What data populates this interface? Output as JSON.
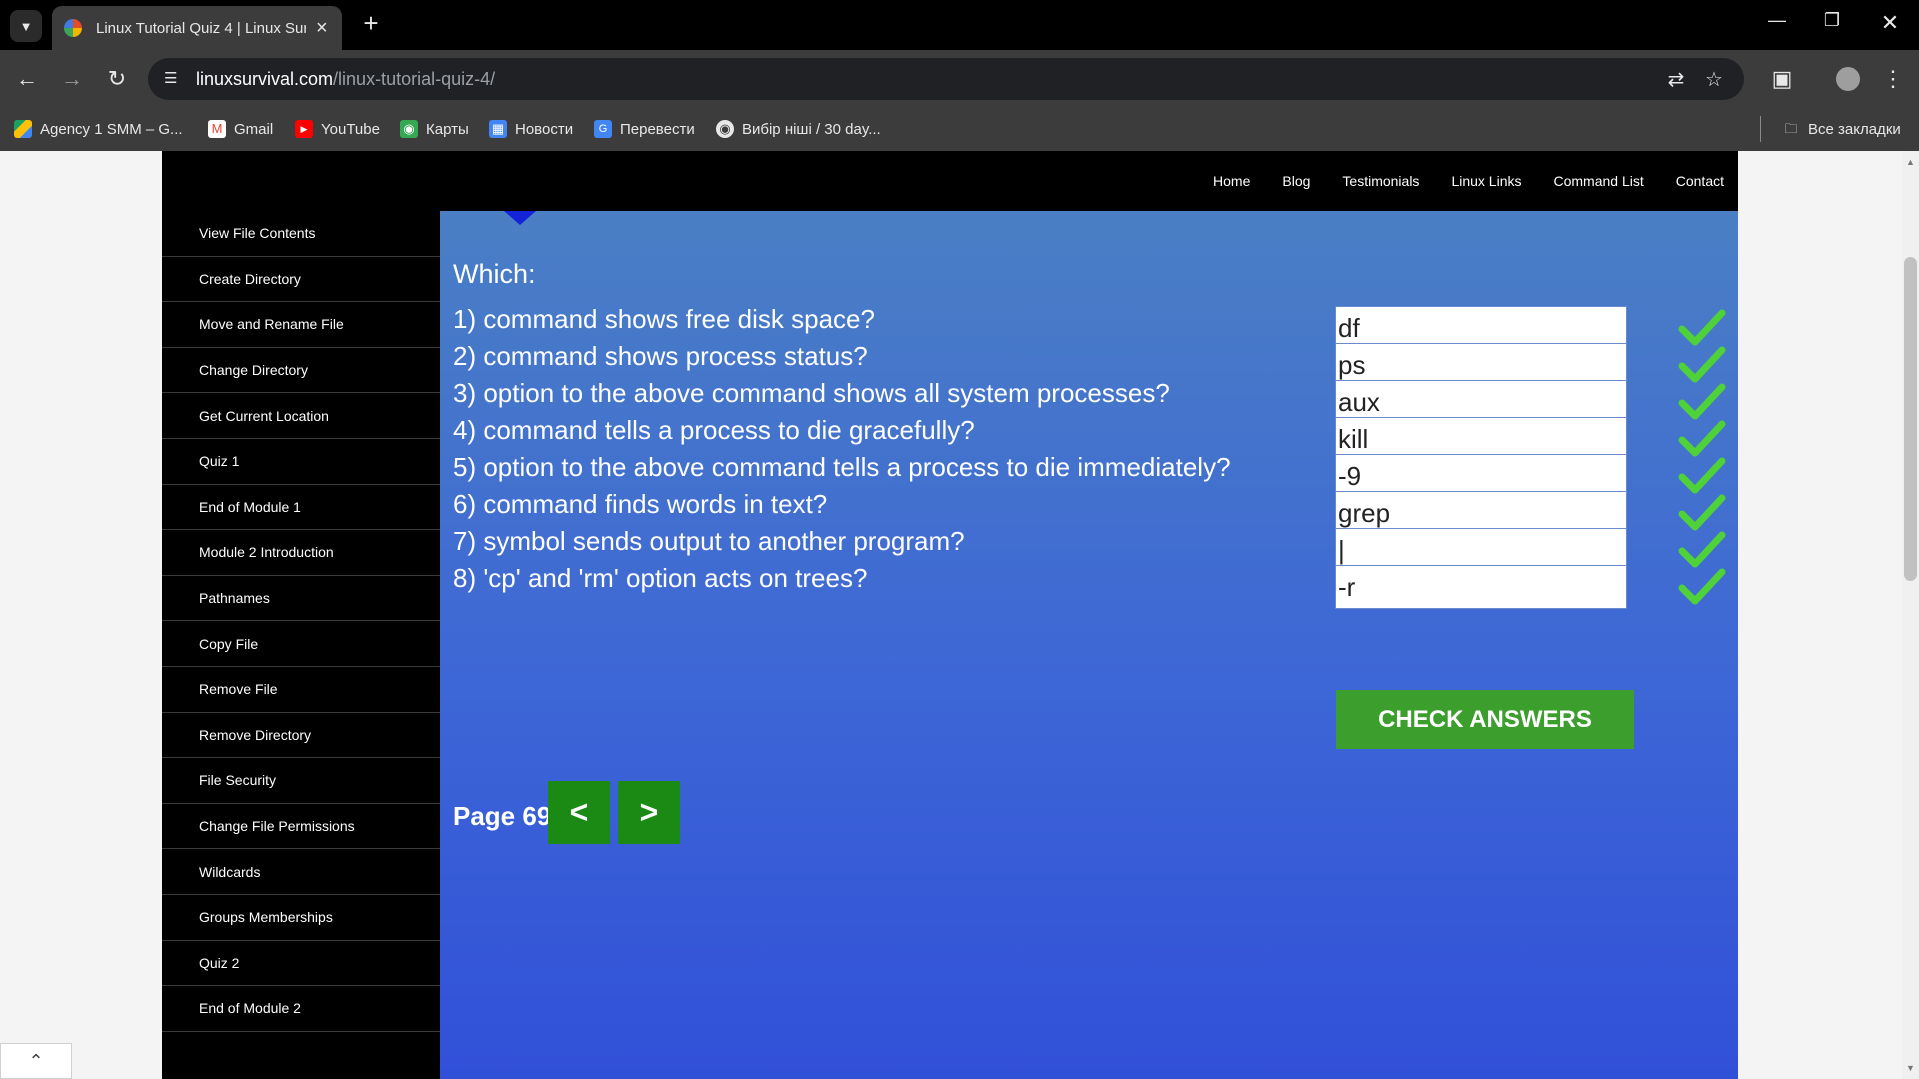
{
  "browser": {
    "tab_title": "Linux Tutorial Quiz 4 | Linux Survival",
    "url_host": "linuxsurvival.com",
    "url_path": "/linux-tutorial-quiz-4/",
    "bookmarks": [
      {
        "label": "Agency 1 SMM – G...",
        "icon": "google-drive-icon"
      },
      {
        "label": "Gmail",
        "icon": "gmail-icon"
      },
      {
        "label": "YouTube",
        "icon": "youtube-icon"
      },
      {
        "label": "Карты",
        "icon": "maps-icon"
      },
      {
        "label": "Новости",
        "icon": "news-icon"
      },
      {
        "label": "Перевести",
        "icon": "translate-icon"
      },
      {
        "label": "Вибір ніші / 30 day...",
        "icon": "globe-icon"
      }
    ],
    "all_bookmarks_label": "Все закладки"
  },
  "top_nav": [
    "Home",
    "Blog",
    "Testimonials",
    "Linux Links",
    "Command List",
    "Contact"
  ],
  "sidebar": [
    "View File Contents",
    "Create Directory",
    "Move and Rename File",
    "Change Directory",
    "Get Current Location",
    "Quiz 1",
    "End of Module 1",
    "Module 2 Introduction",
    "Pathnames",
    "Copy File",
    "Remove File",
    "Remove Directory",
    "File Security",
    "Change File Permissions",
    "Wildcards",
    "Groups Memberships",
    "Quiz 2",
    "End of Module 2"
  ],
  "quiz": {
    "heading": "Which:",
    "questions": [
      {
        "text": "1) command shows free disk space?",
        "answer": "df",
        "correct": true
      },
      {
        "text": "2) command shows process status?",
        "answer": "ps",
        "correct": true
      },
      {
        "text": "3) option to the above command shows all system processes?",
        "answer": "aux",
        "correct": true
      },
      {
        "text": "4) command tells a process to die gracefully?",
        "answer": "kill",
        "correct": true
      },
      {
        "text": "5) option to the above command tells a process to die immediately?",
        "answer": "-9",
        "correct": true
      },
      {
        "text": "6) command finds words in text?",
        "answer": "grep",
        "correct": true
      },
      {
        "text": "7) symbol sends output to another program?",
        "answer": "|",
        "correct": true
      },
      {
        "text": "8) 'cp' and 'rm' option acts on trees?",
        "answer": "-r",
        "correct": true
      }
    ],
    "check_button": "CHECK ANSWERS"
  },
  "pagination": {
    "label": "Page 69",
    "prev": "<",
    "next": ">"
  },
  "colors": {
    "check_green": "#4fd13a",
    "button_green": "#3c9e2d",
    "nav_green": "#1b8a14"
  }
}
